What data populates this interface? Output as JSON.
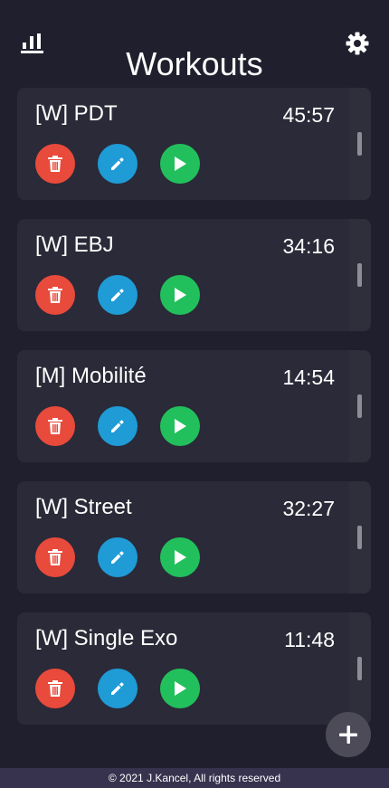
{
  "header": {
    "title": "Workouts",
    "stats_icon": "bar-chart-icon",
    "settings_icon": "gear-icon"
  },
  "workouts": [
    {
      "name": "[W] PDT",
      "duration": "45:57"
    },
    {
      "name": "[W] EBJ",
      "duration": "34:16"
    },
    {
      "name": "[M] Mobilité",
      "duration": "14:54"
    },
    {
      "name": "[W] Street",
      "duration": "32:27"
    },
    {
      "name": "[W] Single Exo",
      "duration": "11:48"
    }
  ],
  "actions": {
    "delete_icon": "trash-icon",
    "edit_icon": "pencil-icon",
    "play_icon": "play-icon"
  },
  "colors": {
    "background": "#201f2d",
    "card": "#2a2a38",
    "delete": "#e84a3b",
    "edit": "#1f9bd6",
    "play": "#22c05c",
    "footer": "#37334f",
    "fab": "#4c4b57"
  },
  "fab": {
    "icon": "plus-icon"
  },
  "footer": {
    "text": "© 2021 J.Kancel, All rights reserved"
  }
}
